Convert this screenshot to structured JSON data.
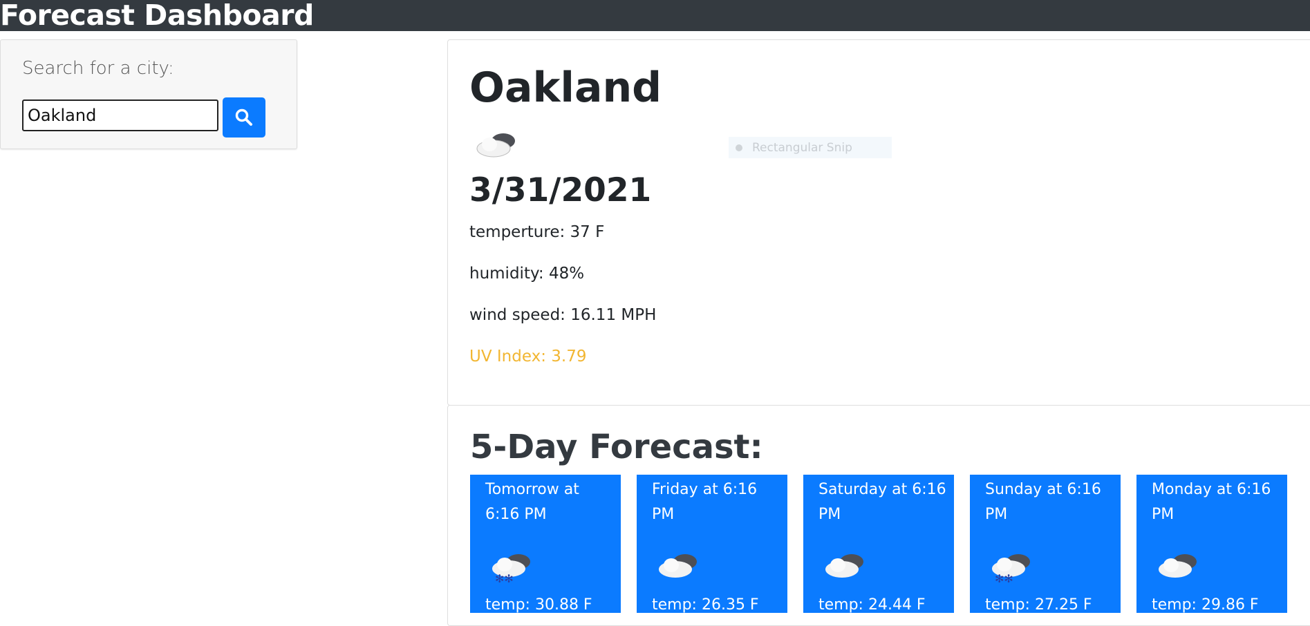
{
  "header": {
    "title": "Forecast Dashboard"
  },
  "search": {
    "label": "Search for a city:",
    "value": "Oakland",
    "button_icon": "search-icon"
  },
  "current": {
    "city": "Oakland",
    "icon": "cloudy-icon",
    "date": "3/31/2021",
    "temperature": "temperture: 37 F",
    "humidity": "humidity: 48%",
    "wind": "wind speed: 16.11 MPH",
    "uv": "UV Index: 3.79",
    "uv_color": "#f2b632"
  },
  "overlay": {
    "snip_label": "Rectangular Snip"
  },
  "forecast": {
    "title": "5-Day Forecast:",
    "accent_color": "#0b7bff",
    "days": [
      {
        "label": "Tomorrow at 6:16 PM",
        "icon": "snow-cloud-icon",
        "temp": "temp: 30.88 F"
      },
      {
        "label": "Friday at 6:16 PM",
        "icon": "cloudy-icon",
        "temp": "temp: 26.35 F"
      },
      {
        "label": "Saturday at 6:16 PM",
        "icon": "cloudy-icon",
        "temp": "temp: 24.44 F"
      },
      {
        "label": "Sunday at 6:16 PM",
        "icon": "snow-cloud-icon",
        "temp": "temp: 27.25 F"
      },
      {
        "label": "Monday at 6:16 PM",
        "icon": "cloudy-icon",
        "temp": "temp: 29.86 F"
      }
    ]
  }
}
